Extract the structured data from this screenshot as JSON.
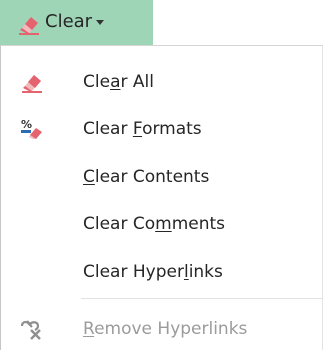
{
  "button": {
    "label": "Clear",
    "icon": "eraser-icon",
    "background": "#9fd5b7"
  },
  "menu": {
    "items": [
      {
        "before": "Cle",
        "accel": "a",
        "after": "r All",
        "icon": "eraser-icon",
        "enabled": true
      },
      {
        "before": "Clear ",
        "accel": "F",
        "after": "ormats",
        "icon": "clear-formats-icon",
        "enabled": true
      },
      {
        "before": "",
        "accel": "C",
        "after": "lear Contents",
        "icon": "",
        "enabled": true
      },
      {
        "before": "Clear Co",
        "accel": "m",
        "after": "ments",
        "icon": "",
        "enabled": true
      },
      {
        "before": "Clear Hyper",
        "accel": "l",
        "after": "inks",
        "icon": "",
        "enabled": true
      },
      {
        "before": "",
        "accel": "R",
        "after": "emove Hyperlinks",
        "icon": "remove-hyperlink-icon",
        "enabled": false
      }
    ]
  },
  "colors": {
    "eraser_pink": "#e4636e",
    "eraser_light": "#f4b9bd",
    "text": "#262626",
    "disabled_text": "#9b9b9b",
    "format_blue": "#2b6cb4"
  }
}
